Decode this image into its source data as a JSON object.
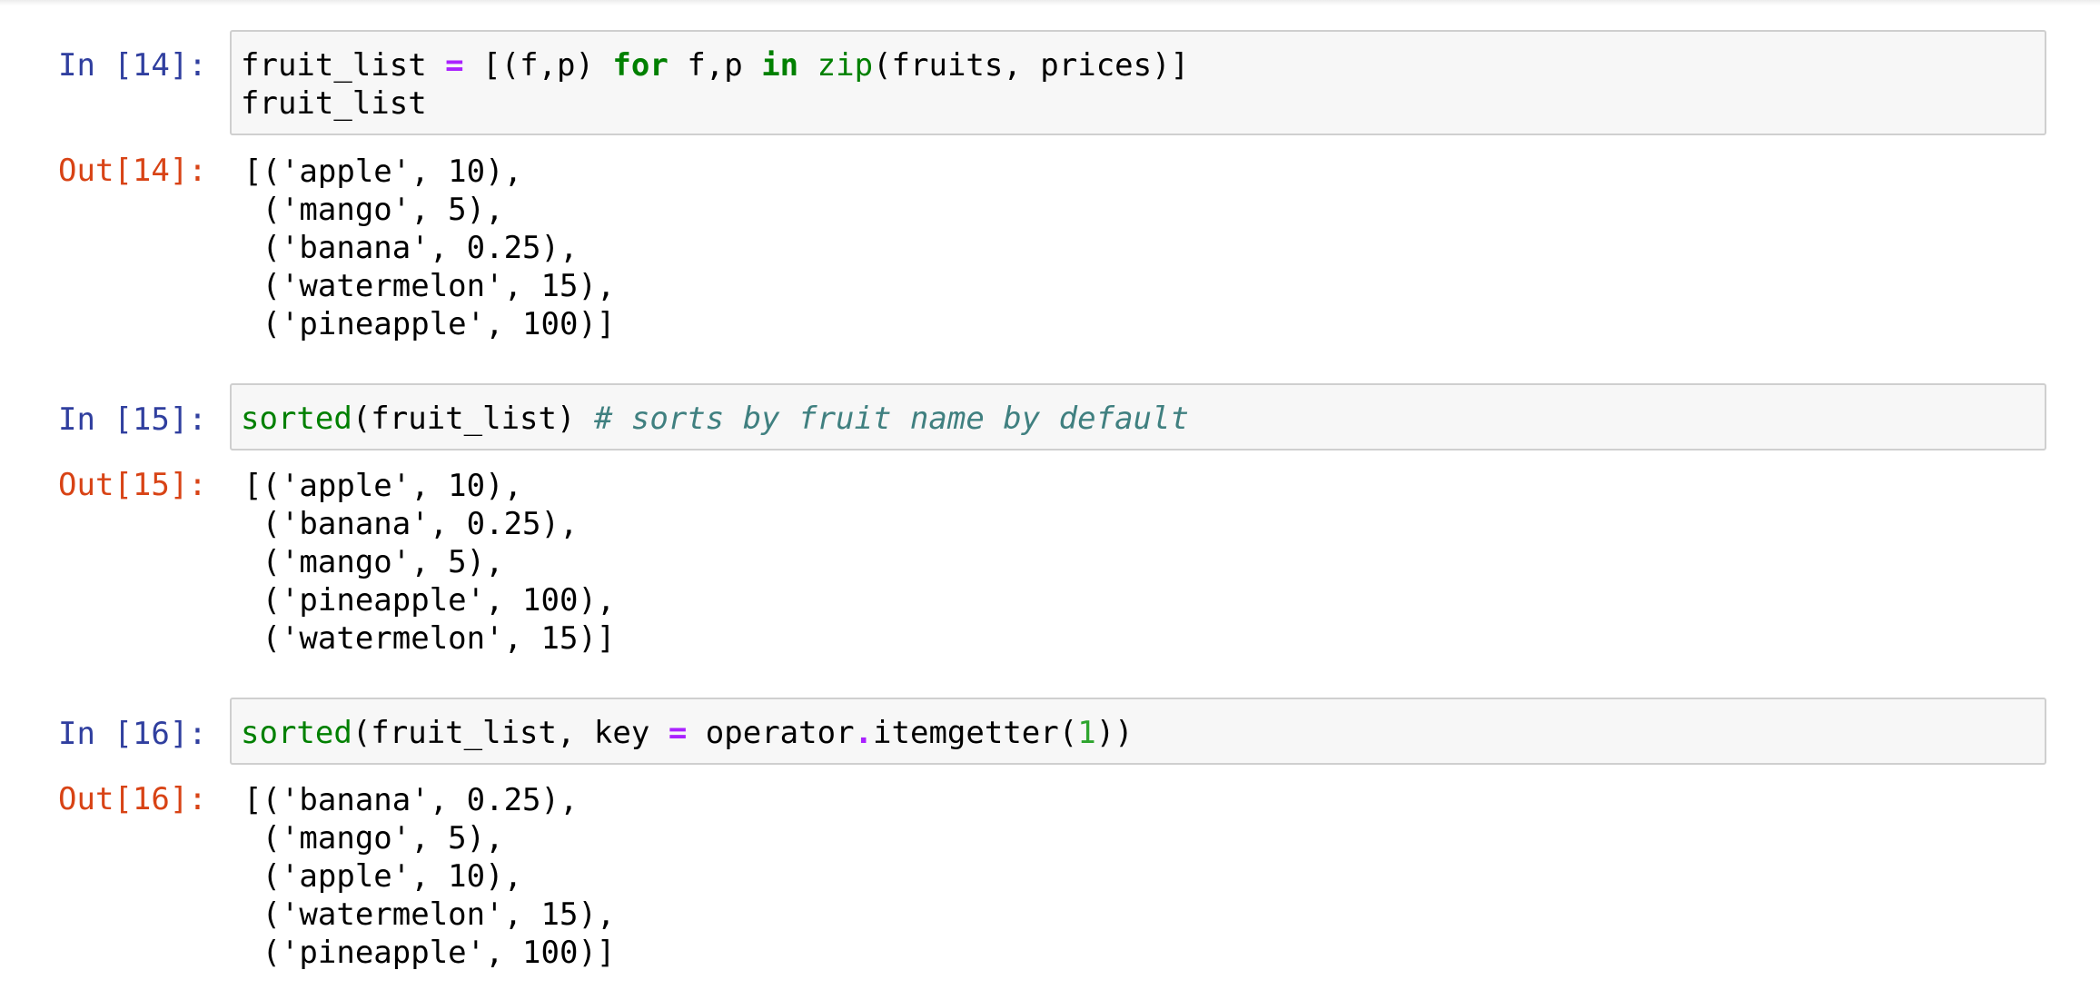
{
  "cells": [
    {
      "in_prompt": "In [14]:",
      "out_prompt": "Out[14]:",
      "input_lines": [
        [
          {
            "t": "fruit_list ",
            "c": ""
          },
          {
            "t": "=",
            "c": "op"
          },
          {
            "t": " [(f,p) ",
            "c": ""
          },
          {
            "t": "for",
            "c": "kw"
          },
          {
            "t": " f,p ",
            "c": ""
          },
          {
            "t": "in",
            "c": "kw"
          },
          {
            "t": " ",
            "c": ""
          },
          {
            "t": "zip",
            "c": "bi"
          },
          {
            "t": "(fruits, prices)]",
            "c": ""
          }
        ],
        [
          {
            "t": "fruit_list",
            "c": ""
          }
        ]
      ],
      "output_lines": [
        "[('apple', 10),",
        " ('mango', 5),",
        " ('banana', 0.25),",
        " ('watermelon', 15),",
        " ('pineapple', 100)]"
      ]
    },
    {
      "in_prompt": "In [15]:",
      "out_prompt": "Out[15]:",
      "input_lines": [
        [
          {
            "t": "sorted",
            "c": "bi"
          },
          {
            "t": "(fruit_list) ",
            "c": ""
          },
          {
            "t": "# sorts by fruit name by default",
            "c": "cm"
          }
        ]
      ],
      "output_lines": [
        "[('apple', 10),",
        " ('banana', 0.25),",
        " ('mango', 5),",
        " ('pineapple', 100),",
        " ('watermelon', 15)]"
      ]
    },
    {
      "in_prompt": "In [16]:",
      "out_prompt": "Out[16]:",
      "input_lines": [
        [
          {
            "t": "sorted",
            "c": "bi"
          },
          {
            "t": "(fruit_list, key ",
            "c": ""
          },
          {
            "t": "=",
            "c": "op"
          },
          {
            "t": " operator",
            "c": ""
          },
          {
            "t": ".",
            "c": "op"
          },
          {
            "t": "itemgetter(",
            "c": ""
          },
          {
            "t": "1",
            "c": "num"
          },
          {
            "t": "))",
            "c": ""
          }
        ]
      ],
      "output_lines": [
        "[('banana', 0.25),",
        " ('mango', 5),",
        " ('apple', 10),",
        " ('watermelon', 15),",
        " ('pineapple', 100)]"
      ]
    }
  ],
  "colors": {
    "in_prompt": "#303f9f",
    "out_prompt": "#d84315",
    "keyword": "#008000",
    "operator": "#aa22ff",
    "number": "#2ea52e",
    "comment": "#408080",
    "input_bg": "#f7f7f7",
    "input_border": "#cfcfcf"
  }
}
